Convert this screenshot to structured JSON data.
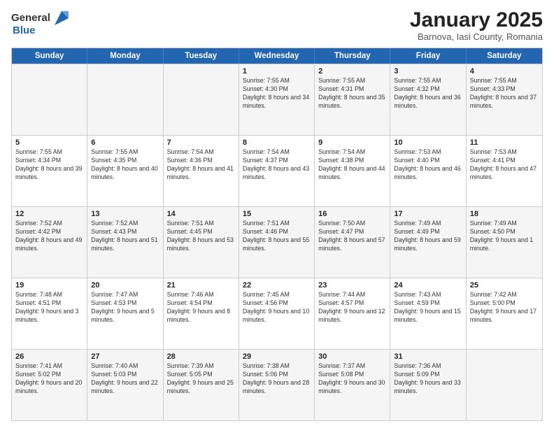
{
  "header": {
    "logo_general": "General",
    "logo_blue": "Blue",
    "title": "January 2025",
    "location": "Barnova, Iasi County, Romania"
  },
  "weekdays": [
    "Sunday",
    "Monday",
    "Tuesday",
    "Wednesday",
    "Thursday",
    "Friday",
    "Saturday"
  ],
  "rows": [
    [
      {
        "day": "",
        "text": ""
      },
      {
        "day": "",
        "text": ""
      },
      {
        "day": "",
        "text": ""
      },
      {
        "day": "1",
        "text": "Sunrise: 7:55 AM\nSunset: 4:30 PM\nDaylight: 8 hours\nand 34 minutes."
      },
      {
        "day": "2",
        "text": "Sunrise: 7:55 AM\nSunset: 4:31 PM\nDaylight: 8 hours\nand 35 minutes."
      },
      {
        "day": "3",
        "text": "Sunrise: 7:55 AM\nSunset: 4:32 PM\nDaylight: 8 hours\nand 36 minutes."
      },
      {
        "day": "4",
        "text": "Sunrise: 7:55 AM\nSunset: 4:33 PM\nDaylight: 8 hours\nand 37 minutes."
      }
    ],
    [
      {
        "day": "5",
        "text": "Sunrise: 7:55 AM\nSunset: 4:34 PM\nDaylight: 8 hours\nand 39 minutes."
      },
      {
        "day": "6",
        "text": "Sunrise: 7:55 AM\nSunset: 4:35 PM\nDaylight: 8 hours\nand 40 minutes."
      },
      {
        "day": "7",
        "text": "Sunrise: 7:54 AM\nSunset: 4:36 PM\nDaylight: 8 hours\nand 41 minutes."
      },
      {
        "day": "8",
        "text": "Sunrise: 7:54 AM\nSunset: 4:37 PM\nDaylight: 8 hours\nand 43 minutes."
      },
      {
        "day": "9",
        "text": "Sunrise: 7:54 AM\nSunset: 4:38 PM\nDaylight: 8 hours\nand 44 minutes."
      },
      {
        "day": "10",
        "text": "Sunrise: 7:53 AM\nSunset: 4:40 PM\nDaylight: 8 hours\nand 46 minutes."
      },
      {
        "day": "11",
        "text": "Sunrise: 7:53 AM\nSunset: 4:41 PM\nDaylight: 8 hours\nand 47 minutes."
      }
    ],
    [
      {
        "day": "12",
        "text": "Sunrise: 7:52 AM\nSunset: 4:42 PM\nDaylight: 8 hours\nand 49 minutes."
      },
      {
        "day": "13",
        "text": "Sunrise: 7:52 AM\nSunset: 4:43 PM\nDaylight: 8 hours\nand 51 minutes."
      },
      {
        "day": "14",
        "text": "Sunrise: 7:51 AM\nSunset: 4:45 PM\nDaylight: 8 hours\nand 53 minutes."
      },
      {
        "day": "15",
        "text": "Sunrise: 7:51 AM\nSunset: 4:46 PM\nDaylight: 8 hours\nand 55 minutes."
      },
      {
        "day": "16",
        "text": "Sunrise: 7:50 AM\nSunset: 4:47 PM\nDaylight: 8 hours\nand 57 minutes."
      },
      {
        "day": "17",
        "text": "Sunrise: 7:49 AM\nSunset: 4:49 PM\nDaylight: 8 hours\nand 59 minutes."
      },
      {
        "day": "18",
        "text": "Sunrise: 7:49 AM\nSunset: 4:50 PM\nDaylight: 9 hours\nand 1 minute."
      }
    ],
    [
      {
        "day": "19",
        "text": "Sunrise: 7:48 AM\nSunset: 4:51 PM\nDaylight: 9 hours\nand 3 minutes."
      },
      {
        "day": "20",
        "text": "Sunrise: 7:47 AM\nSunset: 4:53 PM\nDaylight: 9 hours\nand 5 minutes."
      },
      {
        "day": "21",
        "text": "Sunrise: 7:46 AM\nSunset: 4:54 PM\nDaylight: 9 hours\nand 8 minutes."
      },
      {
        "day": "22",
        "text": "Sunrise: 7:45 AM\nSunset: 4:56 PM\nDaylight: 9 hours\nand 10 minutes."
      },
      {
        "day": "23",
        "text": "Sunrise: 7:44 AM\nSunset: 4:57 PM\nDaylight: 9 hours\nand 12 minutes."
      },
      {
        "day": "24",
        "text": "Sunrise: 7:43 AM\nSunset: 4:59 PM\nDaylight: 9 hours\nand 15 minutes."
      },
      {
        "day": "25",
        "text": "Sunrise: 7:42 AM\nSunset: 5:00 PM\nDaylight: 9 hours\nand 17 minutes."
      }
    ],
    [
      {
        "day": "26",
        "text": "Sunrise: 7:41 AM\nSunset: 5:02 PM\nDaylight: 9 hours\nand 20 minutes."
      },
      {
        "day": "27",
        "text": "Sunrise: 7:40 AM\nSunset: 5:03 PM\nDaylight: 9 hours\nand 22 minutes."
      },
      {
        "day": "28",
        "text": "Sunrise: 7:39 AM\nSunset: 5:05 PM\nDaylight: 9 hours\nand 25 minutes."
      },
      {
        "day": "29",
        "text": "Sunrise: 7:38 AM\nSunset: 5:06 PM\nDaylight: 9 hours\nand 28 minutes."
      },
      {
        "day": "30",
        "text": "Sunrise: 7:37 AM\nSunset: 5:08 PM\nDaylight: 9 hours\nand 30 minutes."
      },
      {
        "day": "31",
        "text": "Sunrise: 7:36 AM\nSunset: 5:09 PM\nDaylight: 9 hours\nand 33 minutes."
      },
      {
        "day": "",
        "text": ""
      }
    ]
  ],
  "alt_rows": [
    0,
    2,
    4
  ]
}
